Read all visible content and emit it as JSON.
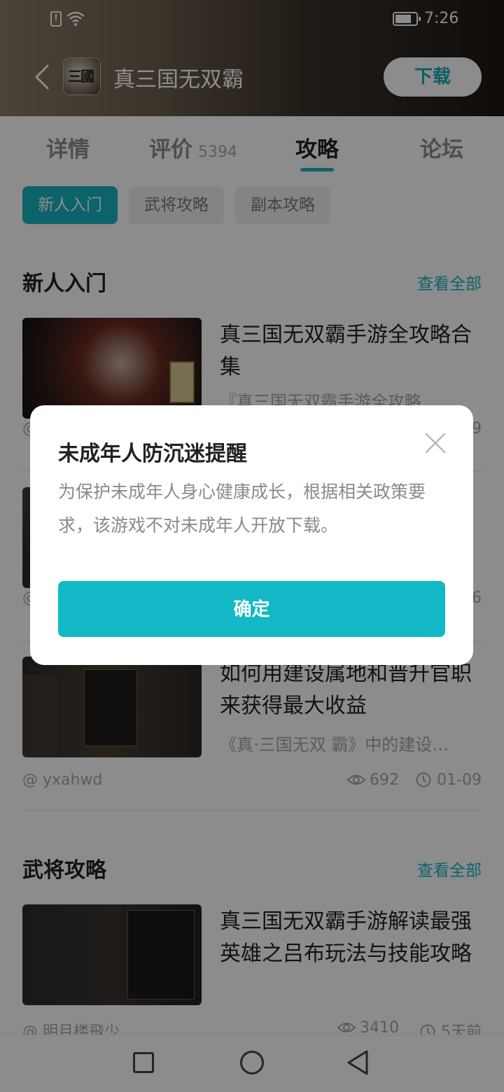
{
  "status_bar": {
    "time": "7:26",
    "sim_label": "!"
  },
  "header": {
    "title": "真三国无双霸",
    "app_icon_text": "三國",
    "download_label": "下载"
  },
  "tabs": [
    {
      "label": "详情",
      "count": ""
    },
    {
      "label": "评价",
      "count": "5394"
    },
    {
      "label": "攻略",
      "count": ""
    },
    {
      "label": "论坛",
      "count": ""
    }
  ],
  "filters": [
    {
      "label": "新人入门",
      "active": true
    },
    {
      "label": "武将攻略",
      "active": false
    },
    {
      "label": "副本攻略",
      "active": false
    }
  ],
  "sections": [
    {
      "title": "新人入门",
      "view_all": "查看全部",
      "articles": [
        {
          "title": "真三国无双霸手游全攻略合集",
          "desc": "『真三国无双霸手游全攻略",
          "author": "@",
          "views": "",
          "date": "9"
        },
        {
          "title": "",
          "desc": "",
          "author": "@",
          "views": "",
          "date": "6"
        },
        {
          "title": "如何用建设属地和晋升官职来获得最大收益",
          "desc": "《真·三国无双 霸》中的建设…",
          "author": "@ yxahwd",
          "views": "692",
          "date": "01-09"
        }
      ]
    },
    {
      "title": "武将攻略",
      "view_all": "查看全部",
      "articles": [
        {
          "title": "真三国无双霸手游解读最强英雄之吕布玩法与技能攻略",
          "desc": "",
          "author": "@ 明月楼飛少",
          "views": "3410",
          "date": "5天前"
        }
      ]
    }
  ],
  "dialog": {
    "title": "未成年人防沉迷提醒",
    "body": "为保护未成年人身心健康成长，根据相关政策要求，该游戏不对未成年人开放下载。",
    "confirm_label": "确定"
  },
  "colors": {
    "accent": "#19b5c2",
    "confirm": "#13b8c6",
    "overlay": "rgba(0,0,0,0.45)"
  }
}
